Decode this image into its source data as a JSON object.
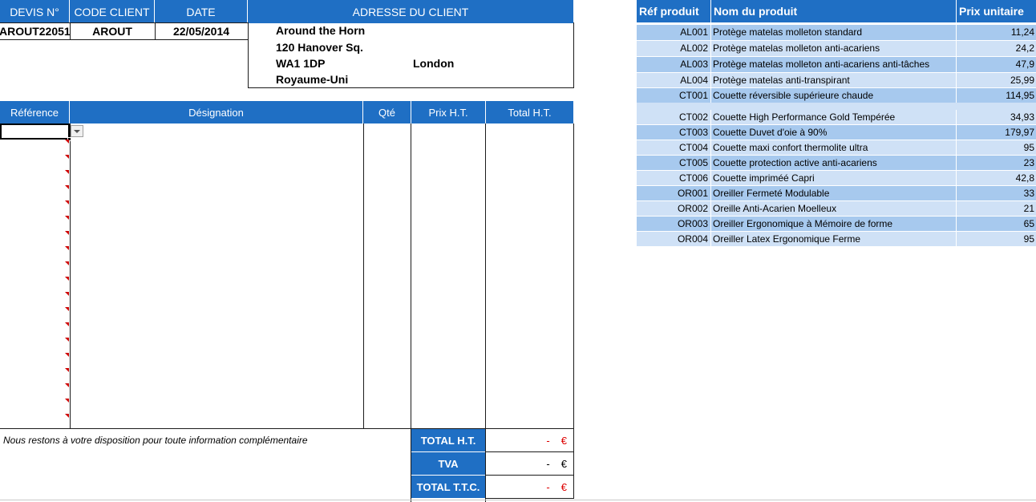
{
  "quote_header": {
    "devis_label": "DEVIS N°",
    "code_label": "CODE CLIENT",
    "date_label": "DATE",
    "address_label": "ADRESSE DU CLIENT",
    "devis_value": "AROUT22051",
    "code_value": "AROUT",
    "date_value": "22/05/2014"
  },
  "client_address": {
    "name": "Around the Horn",
    "street": "120 Hanover Sq.",
    "postcode": "WA1 1DP",
    "city": "London",
    "country": "Royaume-Uni"
  },
  "lines_table": {
    "col_reference": "Référence",
    "col_designation": "Désignation",
    "col_qty": "Qté",
    "col_price": "Prix H.T.",
    "col_total": "Total H.T."
  },
  "footer": {
    "note": "Nous restons à votre disposition pour toute information complémentaire",
    "total_ht_label": "TOTAL H.T.",
    "tva_label": "TVA",
    "total_ttc_label": "TOTAL T.T.C.",
    "total_ht_value": "-",
    "tva_value": "-",
    "total_ttc_value": "-",
    "currency": "€"
  },
  "products": {
    "col_ref": "Réf produit",
    "col_name": "Nom du produit",
    "col_price": "Prix unitaire",
    "rows": [
      {
        "ref": "AL001",
        "name": "Protège matelas molleton standard",
        "price": "11,24"
      },
      {
        "ref": "AL002",
        "name": "Protège matelas molleton anti-acariens",
        "price": "24,2"
      },
      {
        "ref": "AL003",
        "name": "Protège matelas molleton anti-acariens anti-tâches",
        "price": "47,9"
      },
      {
        "ref": "AL004",
        "name": "Protège matelas anti-transpirant",
        "price": "25,99"
      },
      {
        "ref": "CT001",
        "name": "Couette réversible supérieure chaude",
        "price": "114,95"
      },
      {
        "ref": "CT002",
        "name": "Couette High Performance Gold Tempérée",
        "price": "34,93"
      },
      {
        "ref": "CT003",
        "name": "Couette Duvet d'oie à 90%",
        "price": "179,97"
      },
      {
        "ref": "CT004",
        "name": "Couette maxi confort thermolite ultra",
        "price": "95"
      },
      {
        "ref": "CT005",
        "name": "Couette protection active anti-acariens",
        "price": "23"
      },
      {
        "ref": "CT006",
        "name": "Couette impriméé Capri",
        "price": "42,8"
      },
      {
        "ref": "OR001",
        "name": "Oreiller Fermeté Modulable",
        "price": "33"
      },
      {
        "ref": "OR002",
        "name": "Oreille Anti-Acarien Moelleux",
        "price": "21"
      },
      {
        "ref": "OR003",
        "name": "Oreiller Ergonomique à Mémoire de forme",
        "price": "65"
      },
      {
        "ref": "OR004",
        "name": "Oreiller Latex Ergonomique Ferme",
        "price": "95"
      }
    ]
  },
  "colors": {
    "header_blue": "#1f6fc4",
    "row_dark": "#a7c9ee",
    "row_light": "#cfe1f6",
    "total_red": "#dd0000"
  },
  "icons": {
    "dropdown": "chevron-down-icon",
    "validation": "red-triangle-marker"
  }
}
